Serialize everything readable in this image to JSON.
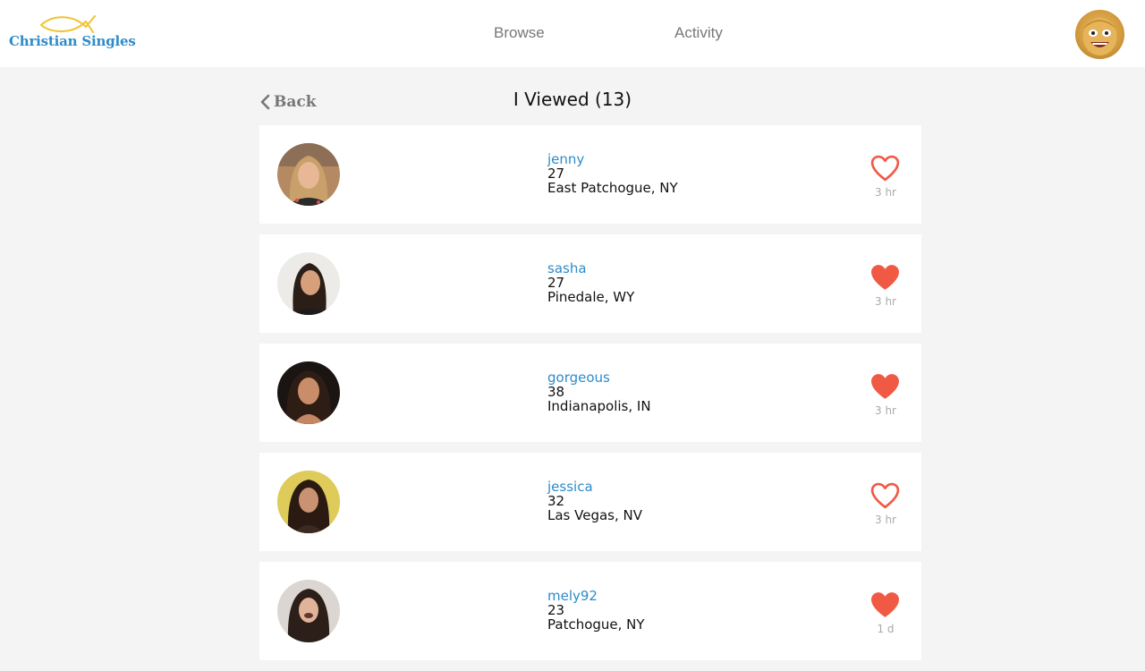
{
  "header": {
    "logo_text": "Christian Singles",
    "nav": [
      {
        "label": "Browse"
      },
      {
        "label": "Activity"
      }
    ]
  },
  "page": {
    "back_label": "Back",
    "title": "I Viewed (13)"
  },
  "colors": {
    "brand_blue": "#2e8bc9",
    "heart_red": "#f05a45",
    "logo_yellow": "#f2c232"
  },
  "profiles": [
    {
      "username": "jenny",
      "age": "27",
      "location": "East Patchogue, NY",
      "liked": false,
      "time": "3 hr"
    },
    {
      "username": "sasha",
      "age": "27",
      "location": "Pinedale, WY",
      "liked": true,
      "time": "3 hr"
    },
    {
      "username": "gorgeous",
      "age": "38",
      "location": "Indianapolis, IN",
      "liked": true,
      "time": "3 hr"
    },
    {
      "username": "jessica",
      "age": "32",
      "location": "Las Vegas, NV",
      "liked": false,
      "time": "3 hr"
    },
    {
      "username": "mely92",
      "age": "23",
      "location": "Patchogue, NY",
      "liked": true,
      "time": "1 d"
    }
  ]
}
